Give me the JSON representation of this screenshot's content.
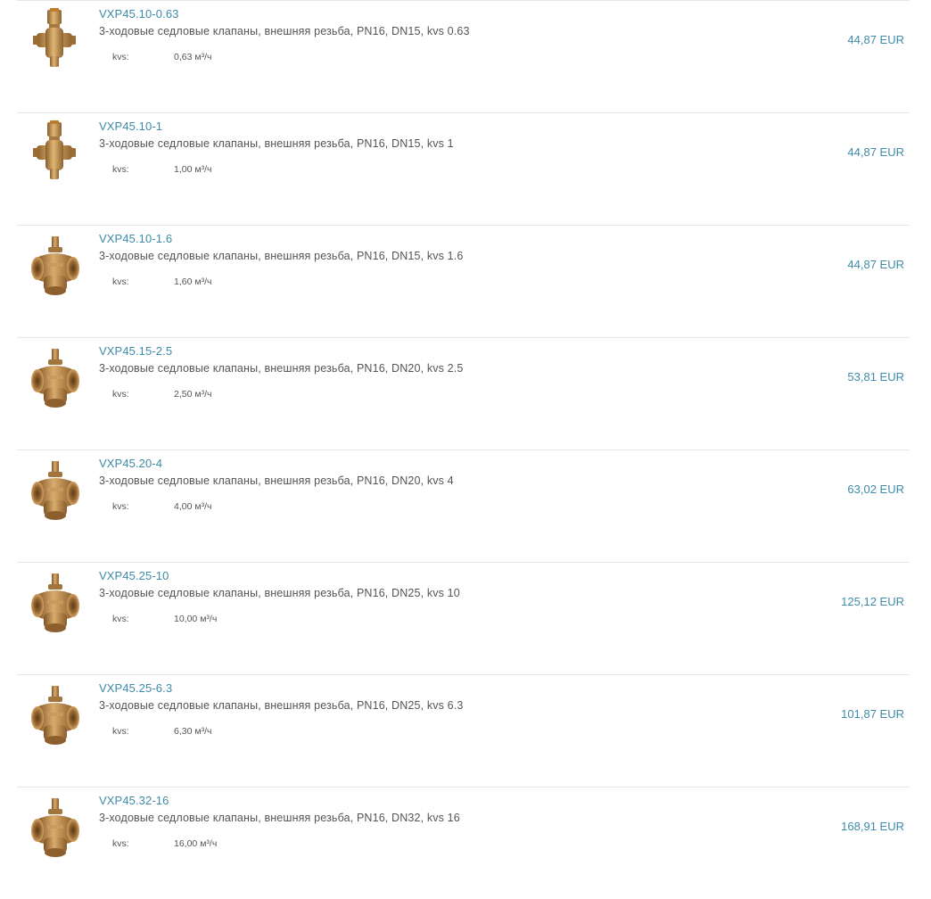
{
  "products": [
    {
      "name": "VXP45.10-0.63",
      "description": "3-ходовые седловые клапаны, внешняя резьба, PN16, DN15, kvs 0.63",
      "spec_label": "kvs:",
      "spec_value": "0,63 м³/ч",
      "price": "44,87 EUR",
      "image": "small-valve"
    },
    {
      "name": "VXP45.10-1",
      "description": "3-ходовые седловые клапаны, внешняя резьба, PN16, DN15, kvs 1",
      "spec_label": "kvs:",
      "spec_value": "1,00 м³/ч",
      "price": "44,87 EUR",
      "image": "small-valve"
    },
    {
      "name": "VXP45.10-1.6",
      "description": "3-ходовые седловые клапаны, внешняя резьба, PN16, DN15, kvs 1.6",
      "spec_label": "kvs:",
      "spec_value": "1,60 м³/ч",
      "price": "44,87 EUR",
      "image": "large-valve"
    },
    {
      "name": "VXP45.15-2.5",
      "description": "3-ходовые седловые клапаны, внешняя резьба, PN16, DN20, kvs 2.5",
      "spec_label": "kvs:",
      "spec_value": "2,50 м³/ч",
      "price": "53,81 EUR",
      "image": "large-valve"
    },
    {
      "name": "VXP45.20-4",
      "description": "3-ходовые седловые клапаны, внешняя резьба, PN16, DN20, kvs 4",
      "spec_label": "kvs:",
      "spec_value": "4,00 м³/ч",
      "price": "63,02 EUR",
      "image": "large-valve"
    },
    {
      "name": "VXP45.25-10",
      "description": "3-ходовые седловые клапаны, внешняя резьба, PN16, DN25, kvs 10",
      "spec_label": "kvs:",
      "spec_value": "10,00 м³/ч",
      "price": "125,12 EUR",
      "image": "large-valve"
    },
    {
      "name": "VXP45.25-6.3",
      "description": "3-ходовые седловые клапаны, внешняя резьба, PN16, DN25, kvs 6.3",
      "spec_label": "kvs:",
      "spec_value": "6,30 м³/ч",
      "price": "101,87 EUR",
      "image": "large-valve"
    },
    {
      "name": "VXP45.32-16",
      "description": "3-ходовые седловые клапаны, внешняя резьба, PN16, DN32, kvs 16",
      "spec_label": "kvs:",
      "spec_value": "16,00 м³/ч",
      "price": "168,91 EUR",
      "image": "large-valve"
    }
  ],
  "colors": {
    "link": "#3e8ba8",
    "text": "#555555",
    "divider": "#e6e6e6",
    "brass": "#b8864a"
  }
}
